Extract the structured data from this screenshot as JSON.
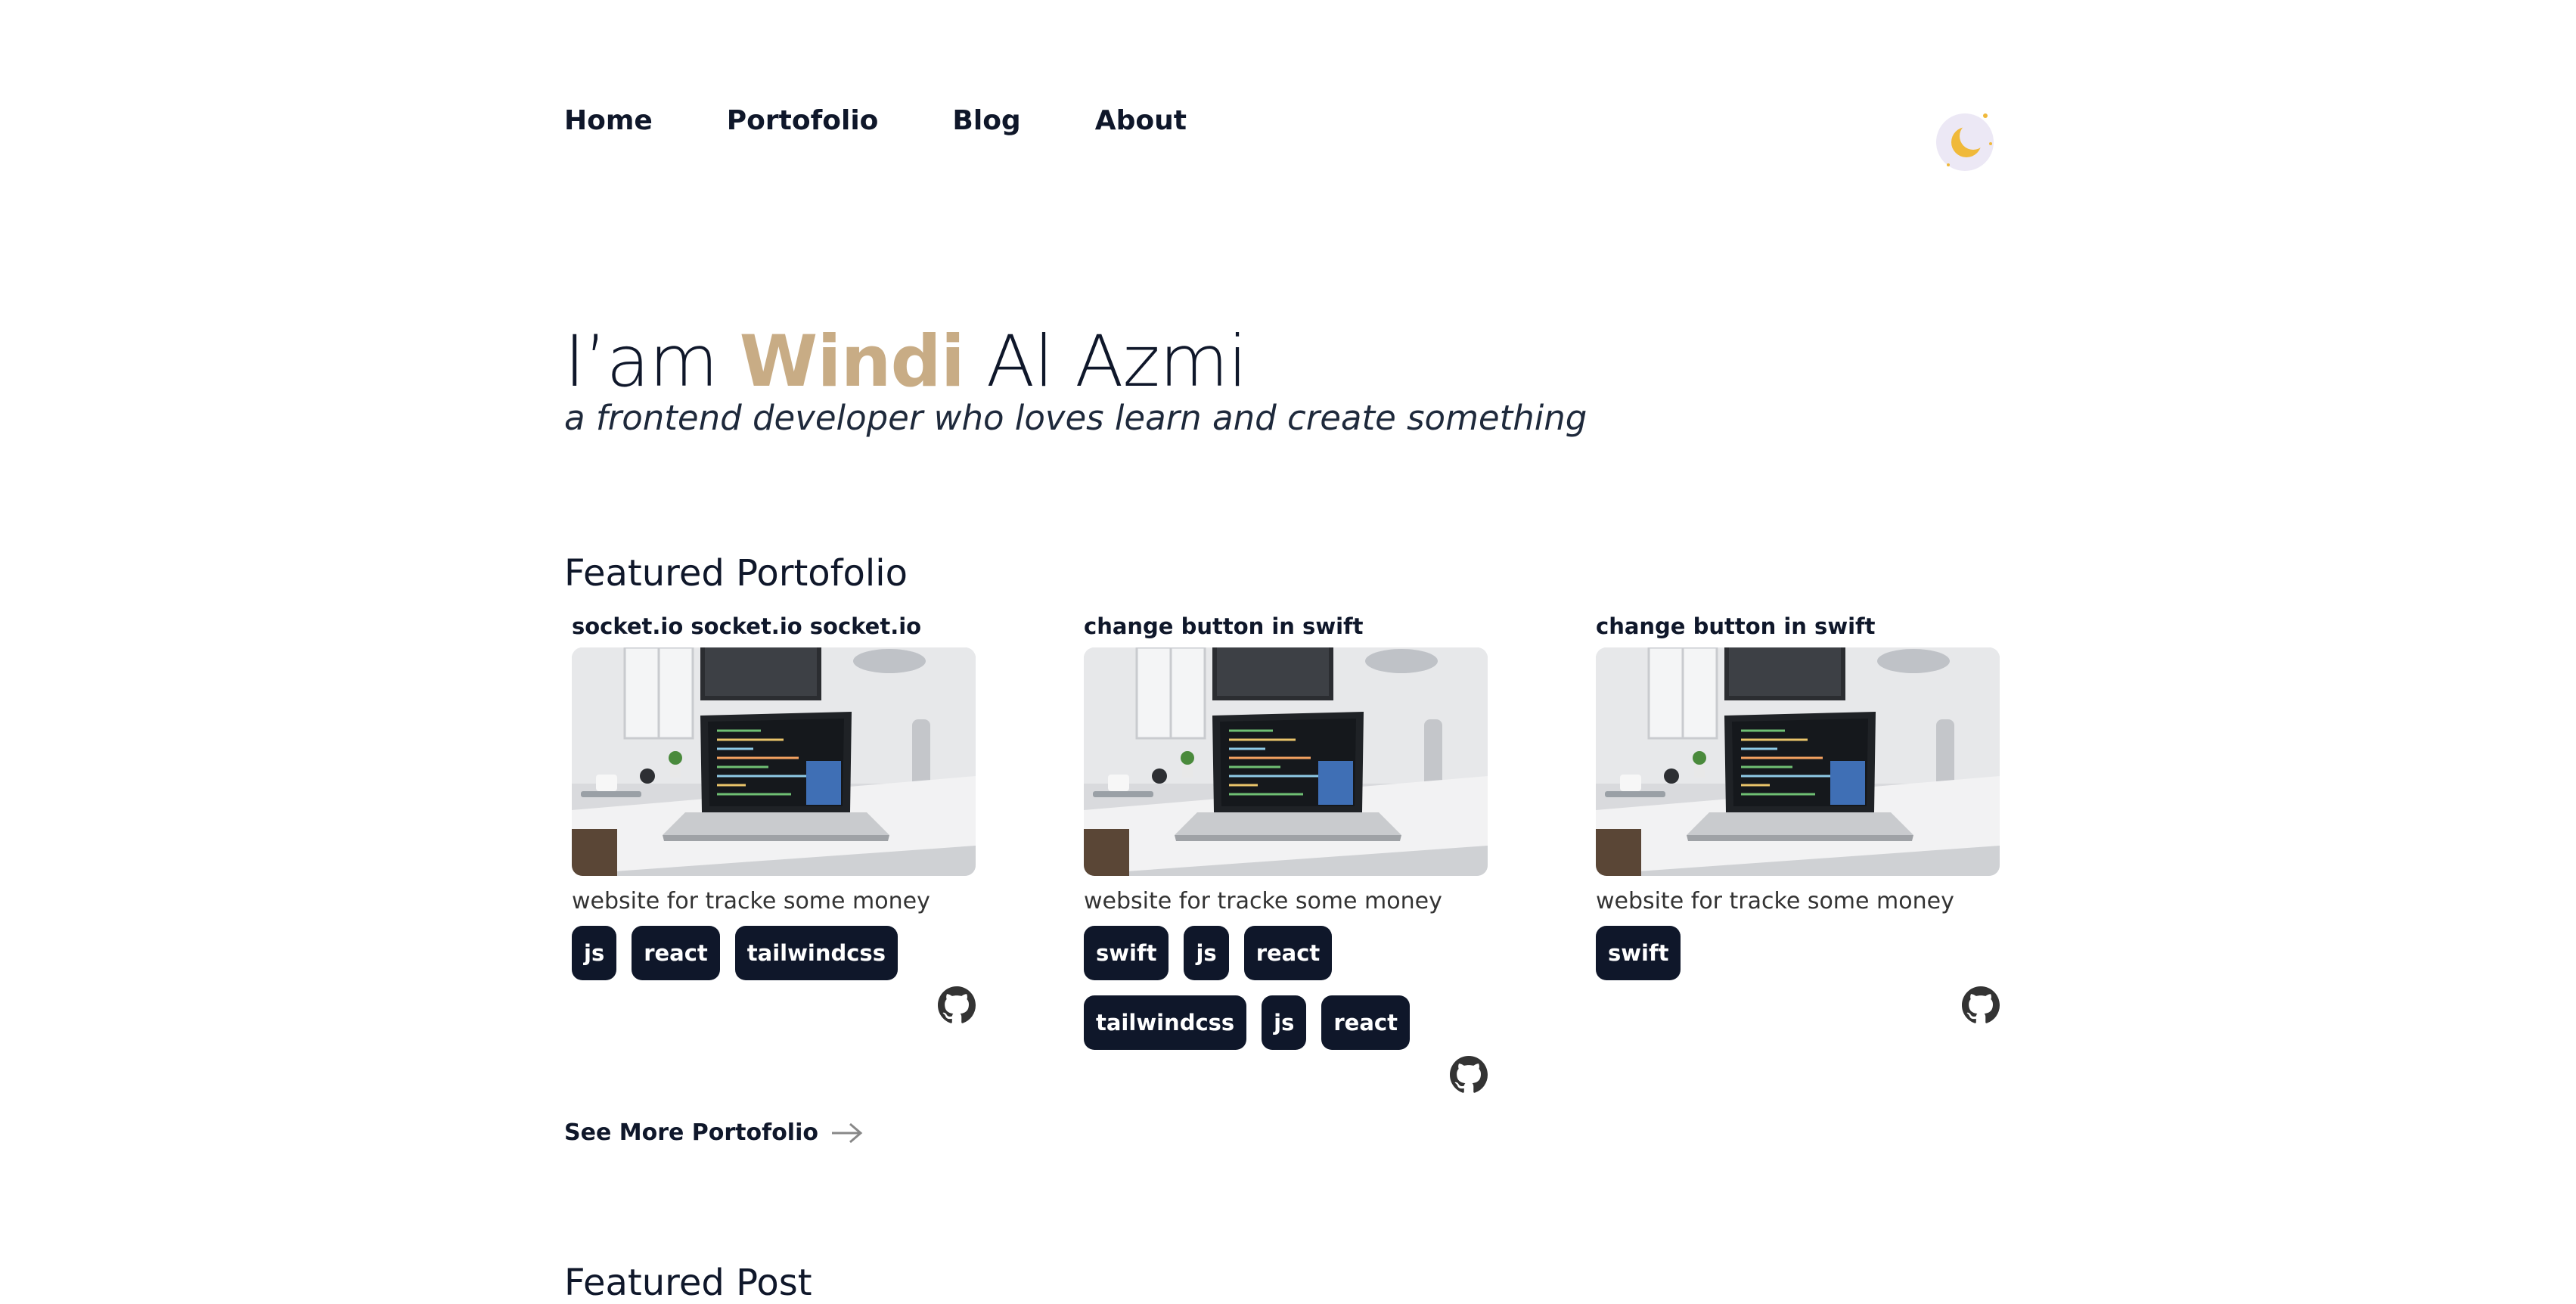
{
  "nav": {
    "items": [
      "Home",
      "Portofolio",
      "Blog",
      "About"
    ]
  },
  "theme_toggle": {
    "icon": "moon-icon"
  },
  "hero": {
    "prefix": "I’am",
    "highlight": "Windi",
    "suffix": "Al Azmi",
    "subtitle": "a frontend developer who loves learn and create something",
    "accent_color": "#c8ac85"
  },
  "featured_portfolio": {
    "title": "Featured Portofolio",
    "cards": [
      {
        "title": "socket.io socket.io socket.io",
        "description": "website for tracke some money",
        "tags": [
          "js",
          "react",
          "tailwindcss"
        ],
        "icon": "github-icon"
      },
      {
        "title": "change button in swift",
        "description": "website for tracke some money",
        "tags": [
          "swift",
          "js",
          "react",
          "tailwindcss",
          "js",
          "react"
        ],
        "icon": "github-icon"
      },
      {
        "title": "change button in swift",
        "description": "website for tracke some money",
        "tags": [
          "swift"
        ],
        "icon": "github-icon"
      }
    ],
    "see_more": "See More Portofolio"
  },
  "featured_post": {
    "title": "Featured Post"
  },
  "colors": {
    "text": "#0f172a",
    "tag_bg": "#0f172a",
    "accent": "#c8ac85",
    "moon": "#f0b93a"
  }
}
